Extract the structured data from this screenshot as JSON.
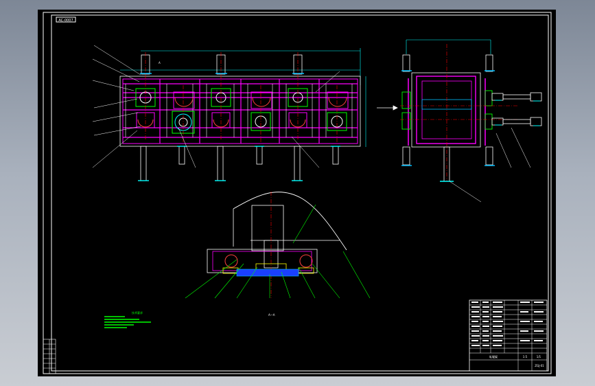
{
  "drawing": {
    "sheet_code_label": "AC-0007",
    "front_view_tag": "A",
    "section_label": "A—A",
    "notes_title": "技术要求",
    "palette": {
      "background": "#000000",
      "frame": "#ffffff",
      "structure": "#ff00ff",
      "centerline": "#ff0000",
      "leader": "#00ff00",
      "dimension": "#00ffff",
      "part": "#ffff00",
      "hidden": "#00bfff"
    }
  },
  "title_block": {
    "drawing_name": "轧辊架",
    "drawing_number": "ZGJ-01",
    "scale": "1:5",
    "sheet": "1/1"
  }
}
